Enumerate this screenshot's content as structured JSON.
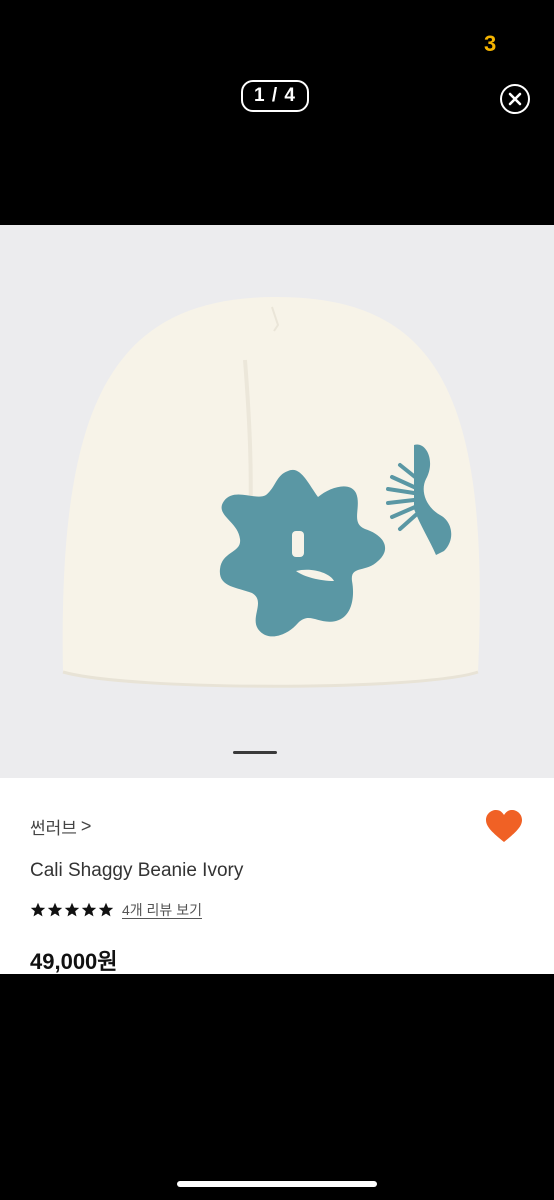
{
  "status": {
    "glyph": "3"
  },
  "viewer": {
    "counter": "1 / 4",
    "close_icon": "close-circle-icon"
  },
  "product": {
    "brand": "썬러브",
    "brand_chevron": ">",
    "title": "Cali Shaggy Beanie Ivory",
    "rating": 5,
    "review_link": "4개 리뷰 보기",
    "price": "49,000원",
    "favorite": true
  },
  "colors": {
    "heart": "#f06125",
    "star": "#111111",
    "beanie_body": "#f7f3e8",
    "beanie_pattern": "#5a97a4"
  }
}
